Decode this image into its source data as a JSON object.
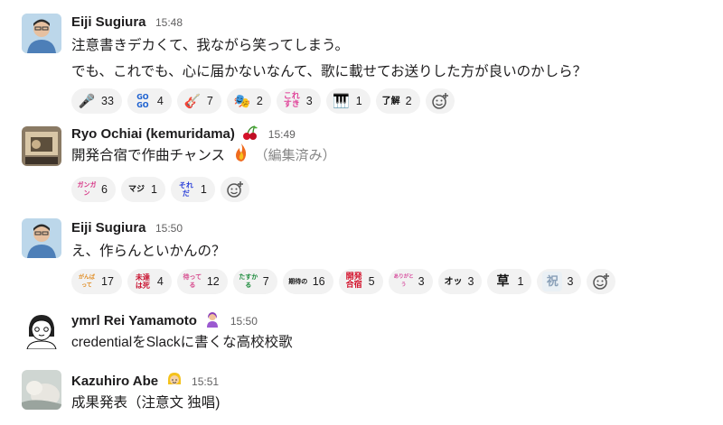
{
  "messages": [
    {
      "author": "Eiji Sugiura",
      "time": "15:48",
      "lines": [
        "注意書きデカくて、我ながら笑ってしまう。",
        "でも、これでも、心に届かないなんて、歌に載せてお送りした方が良いのかしら？"
      ],
      "reactions": [
        {
          "icon": "microphone-icon",
          "label": "🎤",
          "count": "33"
        },
        {
          "icon": "goog-emoji",
          "label": "GO GO",
          "count": "4"
        },
        {
          "icon": "guitar-icon",
          "label": "🎸",
          "count": "7"
        },
        {
          "icon": "singer-face-emoji",
          "label": "🎭",
          "count": "2"
        },
        {
          "icon": "kore-suki-emoji",
          "label": "これすき",
          "count": "3"
        },
        {
          "icon": "piano-icon",
          "label": "🎹",
          "count": "1"
        },
        {
          "icon": "ryokai-emoji",
          "label": "了解",
          "count": "2"
        }
      ]
    },
    {
      "author": "Ryo Ochiai (kemuridama)",
      "time": "15:49",
      "lines": [
        "開発合宿で作曲チャンス"
      ],
      "edited": "（編集済み）",
      "reactions": [
        {
          "icon": "gangan-emoji",
          "label": "ガンガン",
          "count": "6"
        },
        {
          "icon": "maji-emoji",
          "label": "マジ",
          "count": "1"
        },
        {
          "icon": "soreda-emoji",
          "label": "それだ",
          "count": "1"
        }
      ]
    },
    {
      "author": "Eiji Sugiura",
      "time": "15:50",
      "lines": [
        "え、作らんといかんの？"
      ],
      "reactions": [
        {
          "icon": "ganbatte-emoji",
          "label": "がんばって",
          "count": "17"
        },
        {
          "icon": "mikan-wa-shi-emoji",
          "label": "未達は死",
          "count": "4"
        },
        {
          "icon": "matteru-emoji",
          "label": "待ってる",
          "count": "12"
        },
        {
          "icon": "tasukaru-emoji",
          "label": "たすかる",
          "count": "7"
        },
        {
          "icon": "kitai-emoji",
          "label": "期待の",
          "count": "16"
        },
        {
          "icon": "kaihatsu-gassyuku-emoji",
          "label": "開発合宿",
          "count": "5"
        },
        {
          "icon": "arigatou-emoji",
          "label": "ありがとう",
          "count": "3"
        },
        {
          "icon": "ossu-emoji",
          "label": "オッ",
          "count": "3"
        },
        {
          "icon": "kusa-emoji",
          "label": "草",
          "count": "1"
        },
        {
          "icon": "kanji-stamp-emoji",
          "label": "祝",
          "count": "3"
        }
      ]
    },
    {
      "author": "ymrl Rei Yamamoto",
      "time": "15:50",
      "lines": [
        "credentialをSlackに書くな高校校歌"
      ],
      "reactions": []
    },
    {
      "author": "Kazuhiro Abe",
      "time": "15:51",
      "lines": [
        "成果発表（注意文 独唱)"
      ],
      "reactions": []
    }
  ],
  "colors": {
    "reaction_bg": "#f2f2f2",
    "timestamp": "#616061",
    "edited": "#868686"
  }
}
